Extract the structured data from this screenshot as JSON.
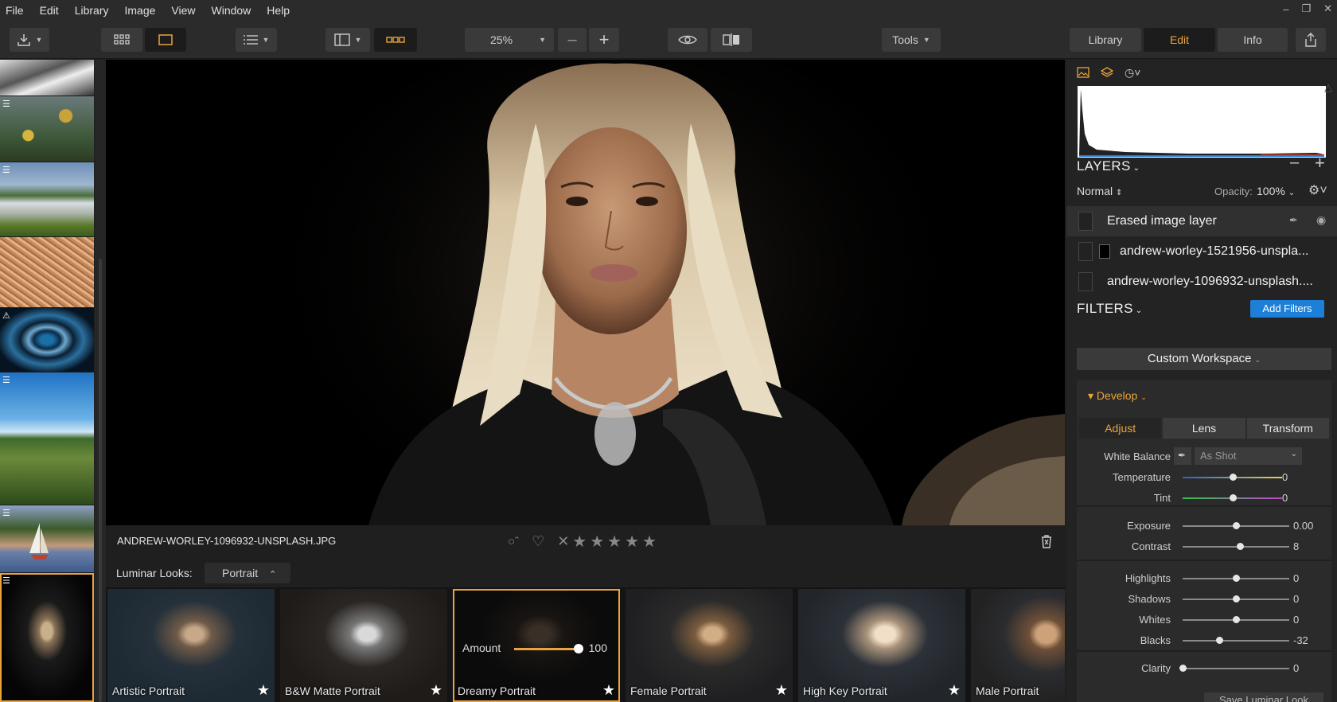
{
  "menu": [
    "File",
    "Edit",
    "Library",
    "Image",
    "View",
    "Window",
    "Help"
  ],
  "toolbar": {
    "zoom": "25%",
    "tools_label": "Tools",
    "view_library": "Library",
    "view_edit": "Edit",
    "view_info": "Info"
  },
  "image": {
    "filename": "ANDREW-WORLEY-1096932-UNSPLASH.JPG"
  },
  "looks": {
    "label": "Luminar Looks:",
    "category": "Portrait",
    "amount_label": "Amount",
    "amount_value": "100",
    "amount": 1.0,
    "items": [
      "Artistic Portrait",
      "B&W Matte Portrait",
      "Dreamy Portrait",
      "Female Portrait",
      "High Key Portrait",
      "Male Portrait"
    ]
  },
  "layers": {
    "title": "LAYERS",
    "blend_mode": "Normal",
    "opacity_label": "Opacity:",
    "opacity_value": "100%",
    "items": [
      "Erased image layer",
      "andrew-worley-1521956-unspla...",
      "andrew-worley-1096932-unsplash...."
    ]
  },
  "filters": {
    "title": "FILTERS",
    "add_button": "Add Filters",
    "workspace": "Custom Workspace",
    "develop_title": "Develop",
    "tabs": [
      "Adjust",
      "Lens",
      "Transform"
    ],
    "white_balance_label": "White Balance",
    "white_balance_value": "As Shot",
    "sliders": [
      {
        "label": "Temperature",
        "value": "0",
        "pos": 0.5
      },
      {
        "label": "Tint",
        "value": "0",
        "pos": 0.5
      },
      {
        "label": "Exposure",
        "value": "0.00",
        "pos": 0.5
      },
      {
        "label": "Contrast",
        "value": "8",
        "pos": 0.54
      },
      {
        "label": "Highlights",
        "value": "0",
        "pos": 0.5
      },
      {
        "label": "Shadows",
        "value": "0",
        "pos": 0.5
      },
      {
        "label": "Whites",
        "value": "0",
        "pos": 0.5
      },
      {
        "label": "Blacks",
        "value": "-32",
        "pos": 0.34
      },
      {
        "label": "Clarity",
        "value": "0",
        "pos": 0.0
      }
    ],
    "save_look": "Save Luminar Look"
  },
  "colors": {
    "accent": "#e9a43c",
    "blue": "#1e7fd8"
  }
}
